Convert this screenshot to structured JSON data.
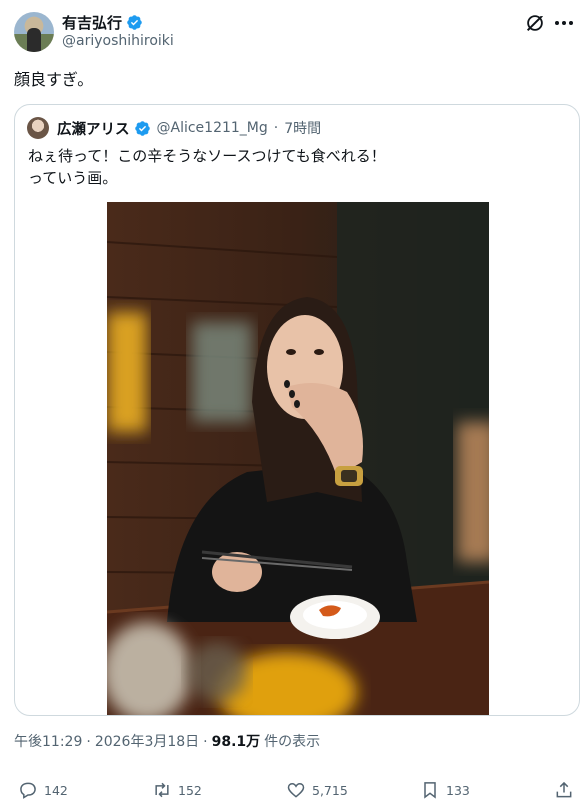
{
  "author": {
    "display_name": "有吉弘行",
    "handle": "@ariyoshihiroiki"
  },
  "post": {
    "text": "顔良すぎ。",
    "time": "午後11:29",
    "separator": "·",
    "date": "2026年3月18日",
    "views_count": "98.1万",
    "views_label": "件の表示"
  },
  "quote": {
    "display_name": "広瀬アリス",
    "handle": "@Alice1211_Mg",
    "separator": "·",
    "relative_time": "7時間",
    "text_line1": "ねぇ待って！この辛そうなソースつけても食べれる！",
    "text_line2": "っていう画。"
  },
  "actions": {
    "replies": "142",
    "reposts": "152",
    "likes": "5,715",
    "bookmarks": "133"
  },
  "colors": {
    "verified": "#1d9bf0",
    "text_primary": "#0f1419",
    "text_secondary": "#536471",
    "border": "#cfd9de"
  },
  "icons": [
    "verified-badge-icon",
    "grok-icon",
    "more-icon",
    "reply-icon",
    "repost-icon",
    "like-icon",
    "bookmark-icon",
    "share-icon"
  ]
}
